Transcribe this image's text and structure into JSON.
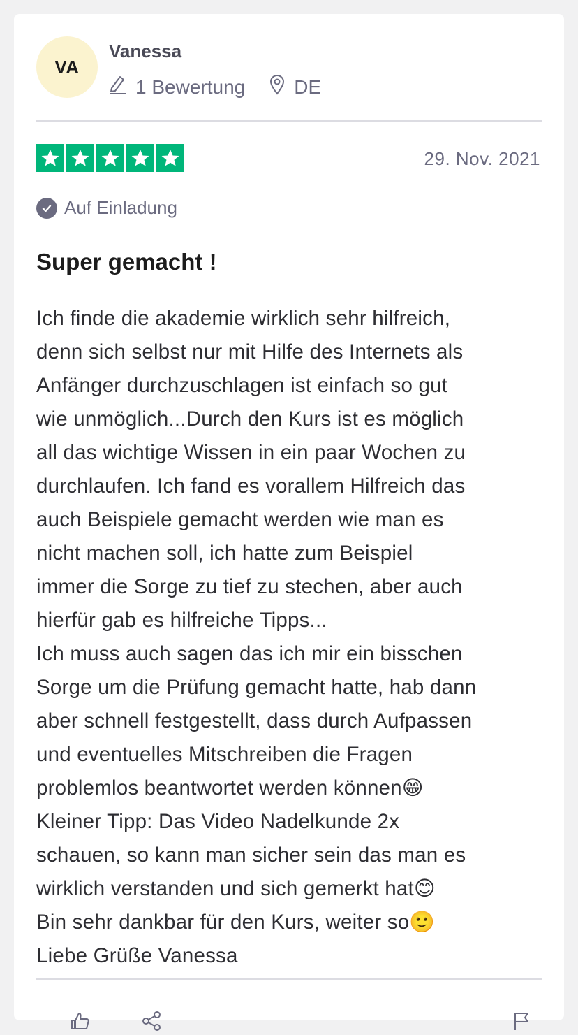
{
  "reviewer": {
    "initials": "VA",
    "name": "Vanessa",
    "review_count": "1 Bewertung",
    "country": "DE"
  },
  "review": {
    "rating": 5,
    "date": "29. Nov. 2021",
    "source_label": "Auf Einladung",
    "title": "Super gemacht !",
    "lines": [
      "Ich finde die akademie wirklich sehr hilfreich,",
      "denn sich selbst nur mit Hilfe des Internets als",
      "Anfänger durchzuschlagen ist einfach so gut",
      "wie unmöglich...Durch den Kurs ist es möglich",
      "all das wichtige Wissen in ein paar Wochen zu",
      "durchlaufen. Ich fand es vorallem Hilfreich das",
      "auch Beispiele gemacht werden wie man es",
      "nicht machen soll, ich hatte zum Beispiel",
      "immer die Sorge zu tief zu stechen, aber auch",
      "hierfür gab es hilfreiche Tipps...",
      "Ich muss auch sagen das ich mir ein bisschen",
      "Sorge um die Prüfung gemacht hatte, hab dann",
      "aber schnell festgestellt, dass durch Aufpassen",
      "und eventuelles Mitschreiben die Fragen",
      "problemlos beantwortet werden können😁",
      "Kleiner Tipp: Das Video Nadelkunde 2x",
      "schauen, so kann man sicher sein das man es",
      "wirklich verstanden und sich gemerkt hat😊",
      "Bin sehr dankbar für den Kurs, weiter so🙂",
      "Liebe Grüße Vanessa"
    ]
  },
  "colors": {
    "star_green": "#00b67a",
    "avatar_bg": "#fbf3cf",
    "muted_text": "#6b6b80"
  },
  "icons": [
    "pencil-icon",
    "location-pin-icon",
    "star-icon",
    "verified-check-icon",
    "thumbs-up-icon",
    "share-icon",
    "flag-icon"
  ]
}
